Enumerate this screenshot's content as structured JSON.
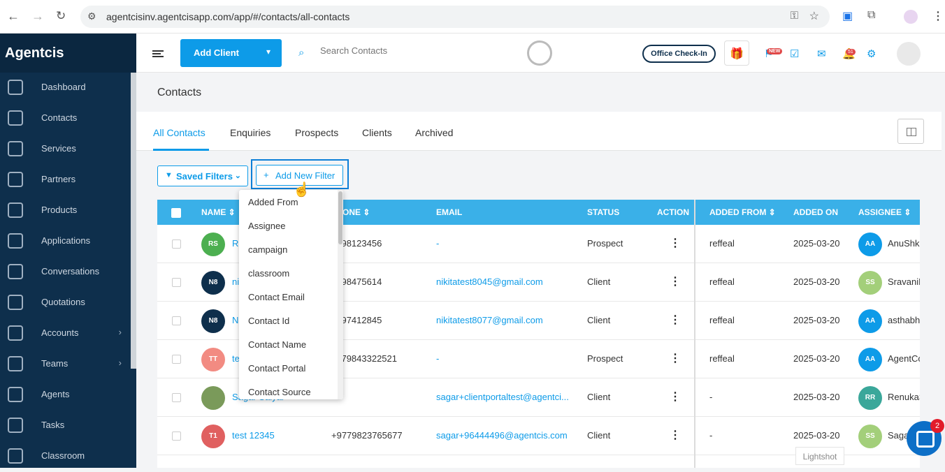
{
  "browser": {
    "url": "agentcisinv.agentcisapp.com/app/#/contacts/all-contacts"
  },
  "sidebar": {
    "brand": "Agentcis",
    "items": [
      {
        "label": "Dashboard",
        "icon": "dashboard-icon"
      },
      {
        "label": "Contacts",
        "icon": "contacts-icon"
      },
      {
        "label": "Services",
        "icon": "services-icon"
      },
      {
        "label": "Partners",
        "icon": "partners-icon"
      },
      {
        "label": "Products",
        "icon": "products-icon"
      },
      {
        "label": "Applications",
        "icon": "applications-icon"
      },
      {
        "label": "Conversations",
        "icon": "conversations-icon"
      },
      {
        "label": "Quotations",
        "icon": "quotations-icon"
      },
      {
        "label": "Accounts",
        "icon": "accounts-icon"
      },
      {
        "label": "Teams",
        "icon": "teams-icon"
      },
      {
        "label": "Agents",
        "icon": "agents-icon"
      },
      {
        "label": "Tasks",
        "icon": "tasks-icon"
      },
      {
        "label": "Classroom",
        "icon": "classroom-icon"
      }
    ]
  },
  "topbar": {
    "add_client": "Add Client",
    "search_placeholder": "Search Contacts",
    "office_checkin": "Office Check-In",
    "new_badge": "NEW",
    "notif_count": "51"
  },
  "page": {
    "title": "Contacts",
    "tabs": [
      "All Contacts",
      "Enquiries",
      "Prospects",
      "Clients",
      "Archived"
    ]
  },
  "filters": {
    "saved_filters": "Saved Filters",
    "add_new_filter": "Add New Filter",
    "options": [
      "Added From",
      "Assignee",
      "campaign",
      "classroom",
      "Contact Email",
      "Contact Id",
      "Contact Name",
      "Contact Portal",
      "Contact Source"
    ]
  },
  "table": {
    "headers": {
      "name": "NAME",
      "phone": "ONE",
      "email": "EMAIL",
      "status": "STATUS",
      "action": "ACTION",
      "added_from": "ADDED FROM",
      "added_on": "ADDED ON",
      "assignee": "ASSIGNEE"
    },
    "rows": [
      {
        "initials": "RS",
        "color": "#4caf50",
        "name": "Re",
        "phone": "9798123456",
        "email": "-",
        "status": "Prospect",
        "added_from": "reffeal",
        "added_on": "2025-03-20",
        "as_initials": "AA",
        "as_color": "#0d9be8",
        "assignee": "AnuShka"
      },
      {
        "initials": "N8",
        "color": "#0e2f4c",
        "name": "ni",
        "phone": "9798475614",
        "email": "nikitatest8045@gmail.com",
        "status": "Client",
        "added_from": "reffeal",
        "added_on": "2025-03-20",
        "as_initials": "SS",
        "as_color": "#a3cf7a",
        "assignee": "SravaniR"
      },
      {
        "initials": "N8",
        "color": "#0e2f4c",
        "name": "Ni",
        "phone": "9797412845",
        "email": "nikitatest8077@gmail.com",
        "status": "Client",
        "added_from": "reffeal",
        "added_on": "2025-03-20",
        "as_initials": "AA",
        "as_color": "#0d9be8",
        "assignee": "asthabh"
      },
      {
        "initials": "TT",
        "color": "#f28b82",
        "name": "te",
        "phone": "9779843322521",
        "email": "-",
        "status": "Prospect",
        "added_from": "reffeal",
        "added_on": "2025-03-20",
        "as_initials": "AA",
        "as_color": "#0d9be8",
        "assignee": "AgentCo"
      },
      {
        "initials": "",
        "color": "#7a9a5a",
        "name": "Sagar Saiyar",
        "phone": "",
        "email": "sagar+clientportaltest@agentci...",
        "status": "Client",
        "added_from": "-",
        "added_on": "2025-03-20",
        "as_initials": "RR",
        "as_color": "#3aa79a",
        "assignee": "RenukaS"
      },
      {
        "initials": "T1",
        "color": "#e06060",
        "name": "test 12345",
        "phone": "+9779823765677",
        "email": "sagar+96444496@agentcis.com",
        "status": "Client",
        "added_from": "-",
        "added_on": "2025-03-20",
        "as_initials": "SS",
        "as_color": "#a3cf7a",
        "assignee": "Sagar"
      }
    ]
  },
  "overlay": {
    "lightshot": "Lightshot",
    "chat_badge": "2"
  }
}
